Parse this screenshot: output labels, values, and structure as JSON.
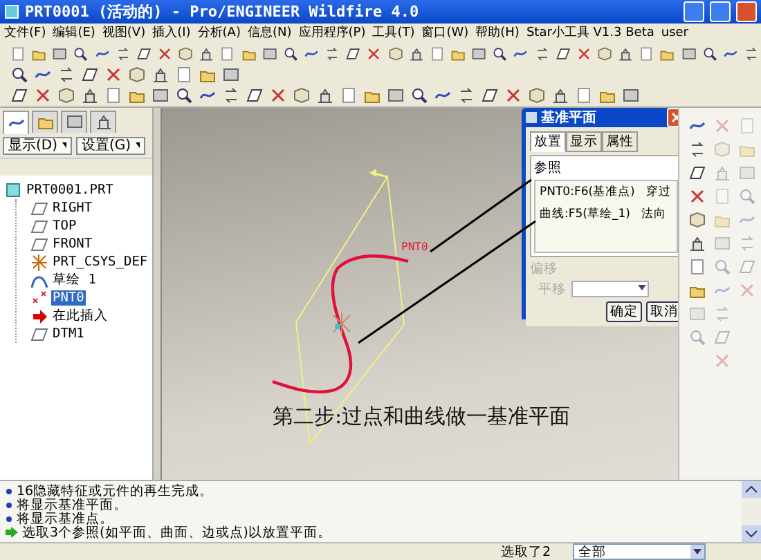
{
  "window": {
    "title": "PRT0001 (活动的) - Pro/ENGINEER Wildfire 4.0"
  },
  "menu": [
    "文件(F)",
    "编辑(E)",
    "视图(V)",
    "插入(I)",
    "分析(A)",
    "信息(N)",
    "应用程序(P)",
    "工具(T)",
    "窗口(W)",
    "帮助(H)",
    "Star小工具 V1.3 Beta",
    "user"
  ],
  "navigator": {
    "tabs": [
      {
        "kind": "tree",
        "selected": true
      },
      {
        "kind": "folders",
        "selected": false
      },
      {
        "kind": "favorites",
        "selected": false
      },
      {
        "kind": "layers",
        "selected": false
      }
    ],
    "buttons": [
      "显示(D)",
      "设置(G)"
    ],
    "tree": {
      "label": "PRT0001.PRT",
      "kind": "part",
      "selected": false,
      "children": [
        {
          "label": "RIGHT",
          "kind": "plane",
          "selected": false
        },
        {
          "label": "TOP",
          "kind": "plane",
          "selected": false
        },
        {
          "label": "FRONT",
          "kind": "plane",
          "selected": false
        },
        {
          "label": "PRT_CSYS_DEF",
          "kind": "csys",
          "selected": false
        },
        {
          "label": "草绘 1",
          "kind": "sketch",
          "selected": false
        },
        {
          "label": "PNT0",
          "kind": "point",
          "selected": true
        },
        {
          "label": "在此插入",
          "kind": "insert",
          "selected": false
        },
        {
          "label": "DTM1",
          "kind": "plane",
          "selected": false
        }
      ]
    }
  },
  "canvas": {
    "point_label": "PNT0",
    "caption": "第二步:过点和曲线做一基准平面"
  },
  "dialog": {
    "title": "基准平面",
    "tabs": [
      {
        "label": "放置",
        "selected": true
      },
      {
        "label": "显示",
        "selected": false
      },
      {
        "label": "属性",
        "selected": false
      }
    ],
    "references_label": "参照",
    "references": [
      {
        "name": "PNT0:F6(基准点)",
        "constraint": "穿过"
      },
      {
        "name": "曲线:F5(草绘_1)",
        "constraint": "法向"
      }
    ],
    "offset_label": "偏移",
    "offset_disabled": true,
    "translate_label": "平移",
    "buttons": [
      "确定",
      "取消"
    ]
  },
  "messages": [
    {
      "kind": "info",
      "text": "16隐藏特征或元件的再生完成。"
    },
    {
      "kind": "info",
      "text": "将显示基准平面。"
    },
    {
      "kind": "info",
      "text": "将显示基准点。"
    },
    {
      "kind": "prompt",
      "text": "选取3个参照(如平面、曲面、边或点)以放置平面。"
    }
  ],
  "status_bar": {
    "selection": "选取了2",
    "filter": "全部"
  }
}
